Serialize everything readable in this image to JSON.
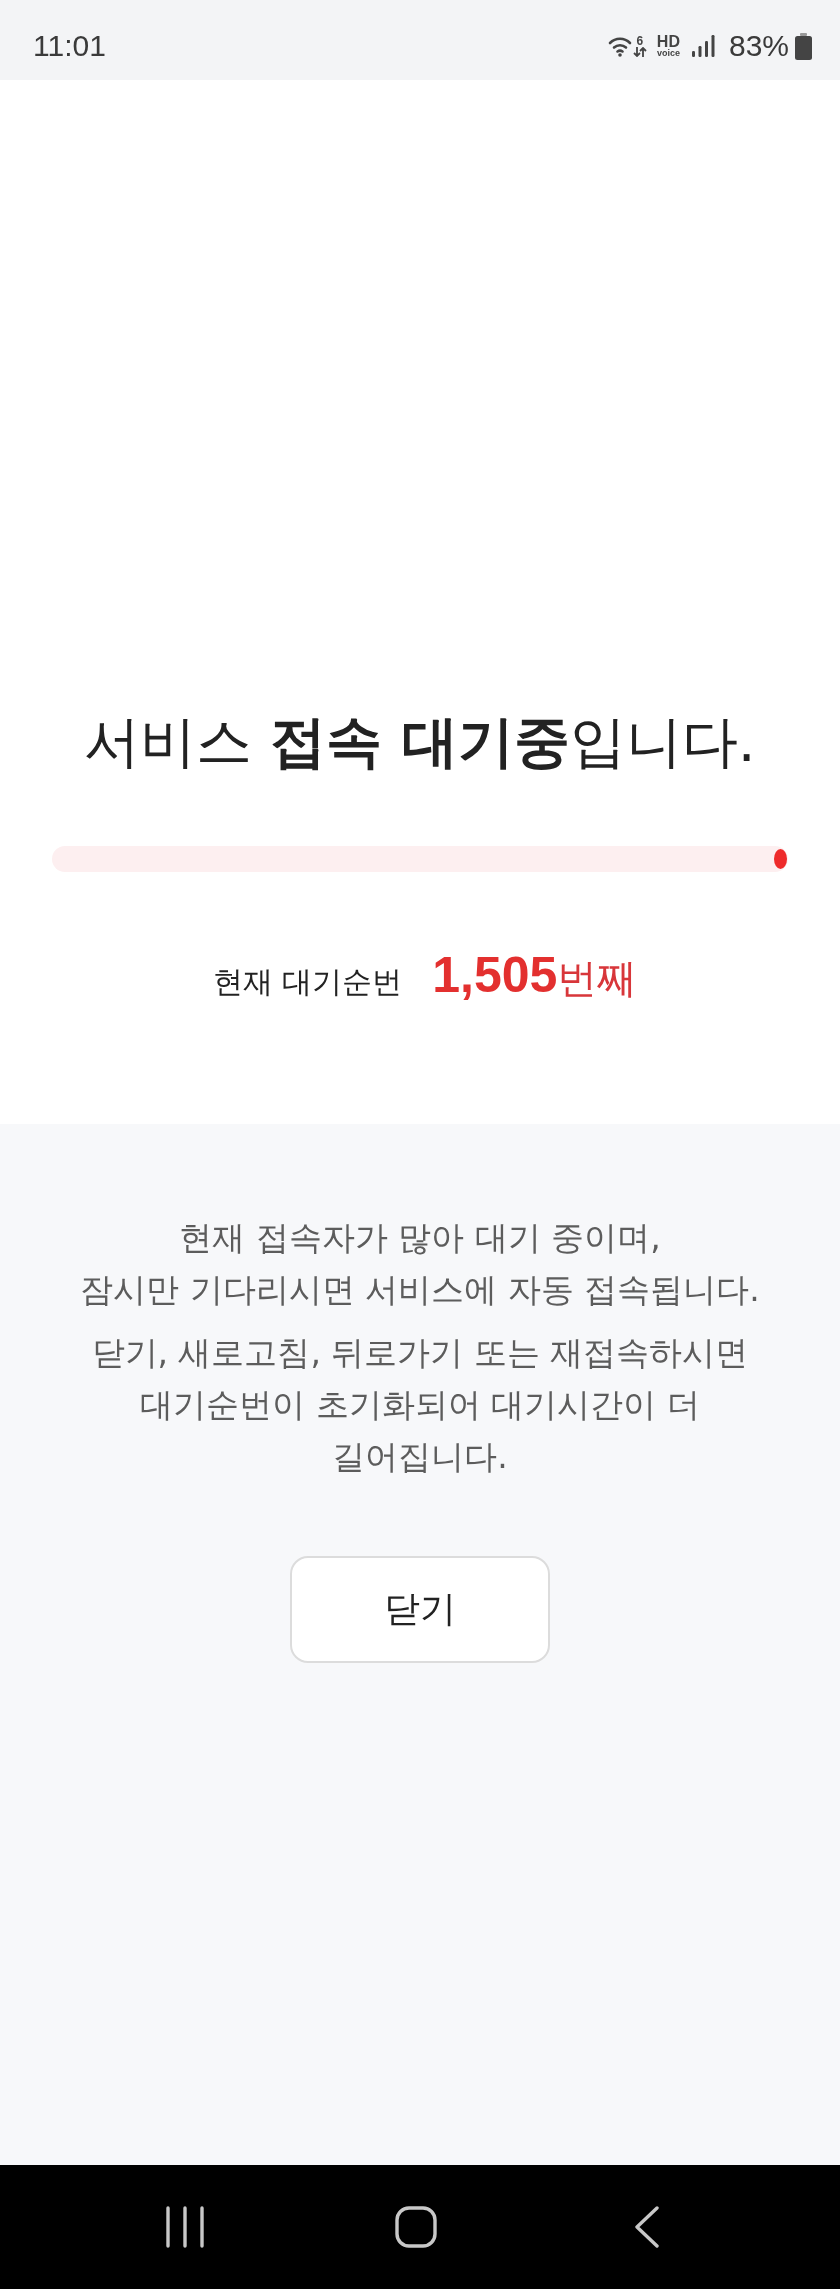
{
  "status_bar": {
    "time": "11:01",
    "wifi_tag": "6",
    "hd_label": "HD",
    "voice_label": "voice",
    "battery_percent": "83%"
  },
  "title": "서비스 **접속 대기중**입니다.",
  "progress": {
    "level": 0.99
  },
  "queue": {
    "label": "현재 대기순번",
    "number": "1,505",
    "suffix": "번째"
  },
  "notice": {
    "paragraphs": [
      "현재 접속자가 많아 대기 중이며,\n잠시만 기다리시면 서비스에 자동 접속됩니다.",
      "닫기, 새로고침, 뒤로가기 또는 재접속하시면\n대기순번이 초기화되어 대기시간이 더\n길어집니다."
    ]
  },
  "close_button": {
    "label": "닫기"
  }
}
